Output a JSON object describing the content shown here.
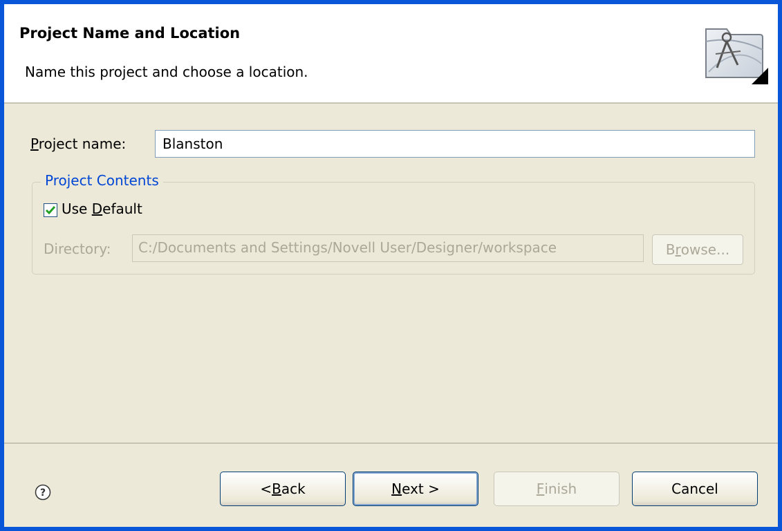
{
  "header": {
    "title": "Project Name and Location",
    "description": "Name this project and choose a location."
  },
  "project_name": {
    "label_prefix": "P",
    "label_rest": "roject name:",
    "value": "Blanston"
  },
  "project_contents": {
    "group_title": "Project Contents",
    "use_default": {
      "checked": true,
      "label_prefix": "Use ",
      "label_underline": "D",
      "label_rest": "efault"
    },
    "directory": {
      "label": "Directory:",
      "value": "C:/Documents and Settings/Novell User/Designer/workspace",
      "enabled": false
    },
    "browse": {
      "label_prefix": "B",
      "label_underline": "r",
      "label_rest": "owse...",
      "enabled": false
    }
  },
  "buttons": {
    "back": {
      "prefix": "< ",
      "underline": "B",
      "rest": "ack"
    },
    "next": {
      "underline": "N",
      "rest": "ext >"
    },
    "finish": {
      "underline": "F",
      "rest": "inish",
      "enabled": false
    },
    "cancel": {
      "label": "Cancel"
    }
  },
  "colors": {
    "accent": "#0a56d8",
    "group_title": "#0046d5",
    "disabled_text": "#aca899",
    "panel": "#ece9d8"
  },
  "icons": {
    "banner": "wizard-project-icon",
    "help": "help-icon",
    "check": "checkmark-icon"
  }
}
